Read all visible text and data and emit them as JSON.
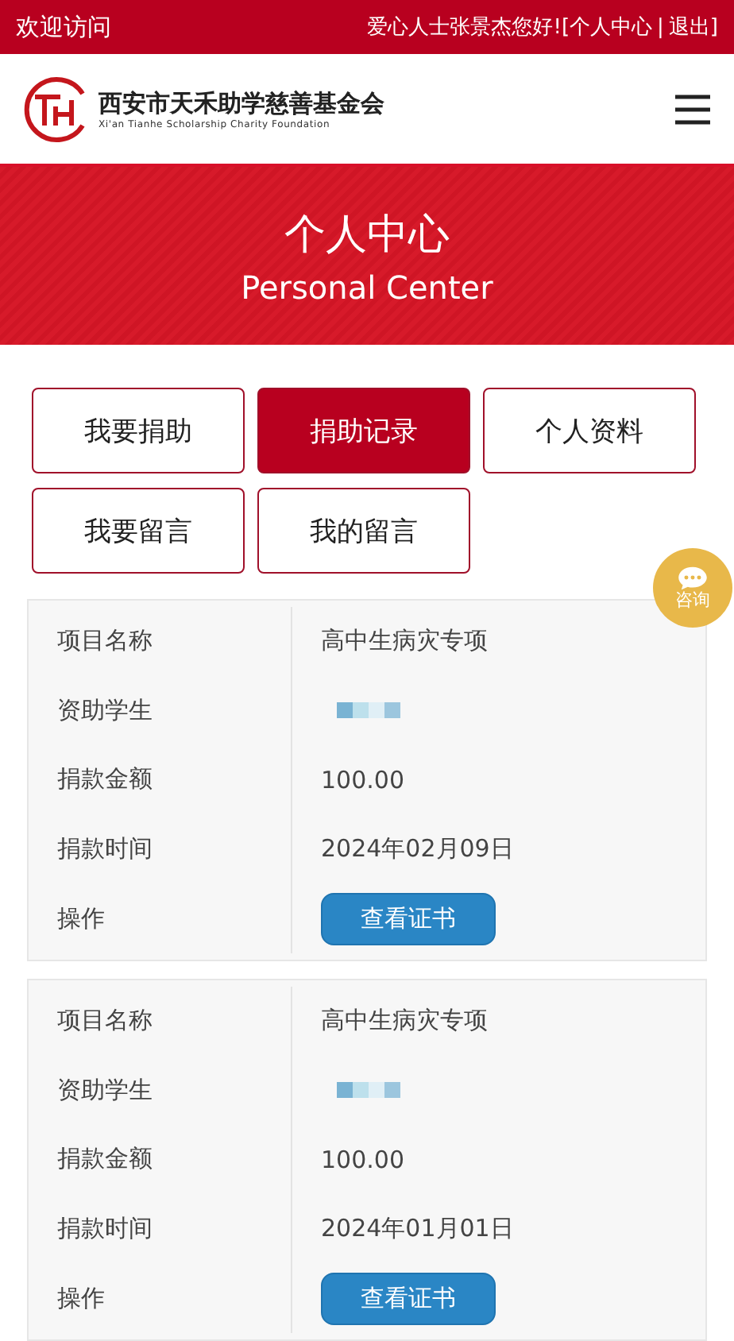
{
  "top_bar": {
    "welcome": "欢迎访问",
    "greeting": "爱心人士张景杰您好!",
    "bracket_open": "[",
    "center_link": "个人中心",
    "separator": "|",
    "logout_link": "退出",
    "bracket_close": "]"
  },
  "header": {
    "org_name": "西安市天禾助学慈善基金会",
    "org_name_en": "Xi'an Tianhe Scholarship Charity Foundation"
  },
  "banner": {
    "title": "个人中心",
    "subtitle": "Personal Center"
  },
  "tabs": [
    {
      "label": "我要捐助",
      "selected": false
    },
    {
      "label": "捐助记录",
      "selected": true
    },
    {
      "label": "个人资料",
      "selected": false
    },
    {
      "label": "我要留言",
      "selected": false
    },
    {
      "label": "我的留言",
      "selected": false
    }
  ],
  "consult_button": {
    "label": "咨询"
  },
  "records": [
    {
      "rows": [
        {
          "kind": "text",
          "label": "项目名称",
          "value": "高中生病灾专项"
        },
        {
          "kind": "redacted",
          "label": "资助学生"
        },
        {
          "kind": "text",
          "label": "捐款金额",
          "value": "100.00"
        },
        {
          "kind": "text",
          "label": "捐款时间",
          "value": "2024年02月09日"
        },
        {
          "kind": "button",
          "label": "操作",
          "value": "查看证书"
        }
      ]
    },
    {
      "rows": [
        {
          "kind": "text",
          "label": "项目名称",
          "value": "高中生病灾专项"
        },
        {
          "kind": "redacted",
          "label": "资助学生"
        },
        {
          "kind": "text",
          "label": "捐款金额",
          "value": "100.00"
        },
        {
          "kind": "text",
          "label": "捐款时间",
          "value": "2024年01月01日"
        },
        {
          "kind": "button",
          "label": "操作",
          "value": "查看证书"
        }
      ]
    }
  ]
}
